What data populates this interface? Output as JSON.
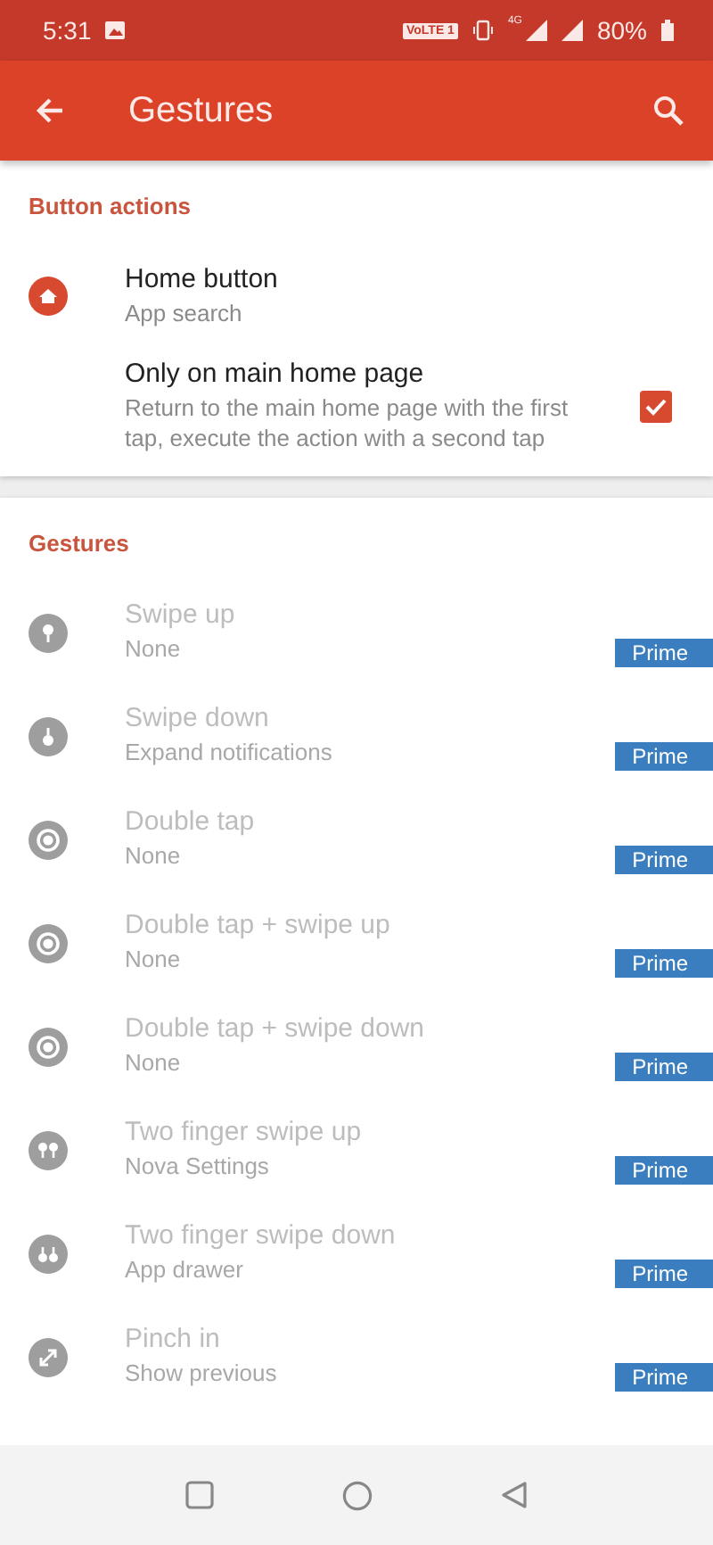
{
  "status_bar": {
    "time": "5:31",
    "volte": "VoLTE 1",
    "network": "4G",
    "battery": "80%"
  },
  "app_bar": {
    "title": "Gestures"
  },
  "sections": [
    {
      "header": "Button actions",
      "items": [
        {
          "kind": "home",
          "title": "Home button",
          "subtitle": "App search",
          "disabled": false
        },
        {
          "kind": "check",
          "title": "Only on main home page",
          "subtitle": "Return to the main home page with the first tap, execute the action with a second tap",
          "checked": true,
          "disabled": false
        }
      ]
    },
    {
      "header": "Gestures",
      "items": [
        {
          "kind": "swipeup",
          "title": "Swipe up",
          "subtitle": "None",
          "badge": "Prime",
          "disabled": true
        },
        {
          "kind": "swipedown",
          "title": "Swipe down",
          "subtitle": "Expand notifications",
          "badge": "Prime",
          "disabled": true
        },
        {
          "kind": "doubletap",
          "title": "Double tap",
          "subtitle": "None",
          "badge": "Prime",
          "disabled": true
        },
        {
          "kind": "doubletap",
          "title": "Double tap + swipe up",
          "subtitle": "None",
          "badge": "Prime",
          "disabled": true
        },
        {
          "kind": "doubletap",
          "title": "Double tap + swipe down",
          "subtitle": "None",
          "badge": "Prime",
          "disabled": true
        },
        {
          "kind": "twoup",
          "title": "Two finger swipe up",
          "subtitle": "Nova Settings",
          "badge": "Prime",
          "disabled": true
        },
        {
          "kind": "twodown",
          "title": "Two finger swipe down",
          "subtitle": "App drawer",
          "badge": "Prime",
          "disabled": true
        },
        {
          "kind": "pinch",
          "title": "Pinch in",
          "subtitle": "Show previous",
          "badge": "Prime",
          "disabled": true
        }
      ]
    }
  ]
}
